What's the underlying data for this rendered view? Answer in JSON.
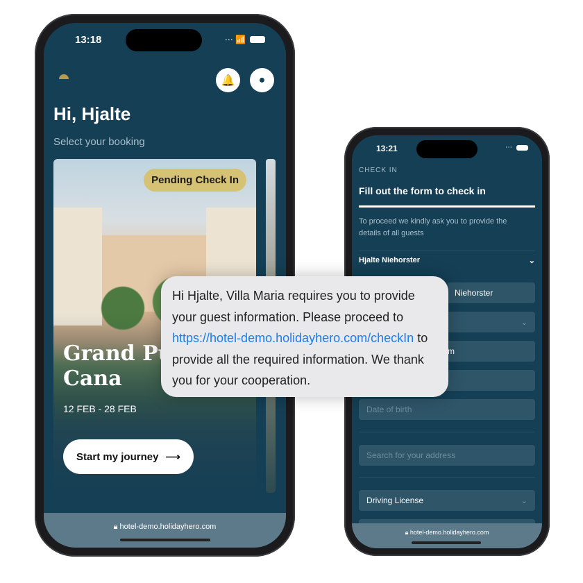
{
  "phone_left": {
    "status": {
      "time": "13:18"
    },
    "greeting": "Hi, Hjalte",
    "subtitle": "Select your booking",
    "icons": {
      "notifications": "bell-icon",
      "profile": "user-icon",
      "logo": "hotel-logo"
    },
    "booking": {
      "badge": "Pending Check In",
      "hotel": "Grand Punta Cana",
      "dates": "12 FEB - 28 FEB",
      "button": "Start my journey",
      "button_icon": "arrow-right"
    },
    "url": "hotel-demo.holidayhero.com"
  },
  "phone_right": {
    "status": {
      "time": "13:21"
    },
    "eyebrow": "CHECK IN",
    "title": "Fill out the form to check in",
    "intro": "To proceed we kindly ask you to provide the details of all guests",
    "guest": "Hjalte Niehorster",
    "fields": {
      "last_name": "Niehorster",
      "partial": "m",
      "dob_placeholder": "Date of birth",
      "address_placeholder": "Search for your address",
      "document_type": "Driving License"
    },
    "url": "hotel-demo.holidayhero.com"
  },
  "message": {
    "text_before": "Hi Hjalte, Villa Maria requires you to provide your guest information. Please proceed to",
    "link": "https://hotel-demo.holidayhero.com/checkIn",
    "text_after": "to provide all the required information. We thank you for your cooperation."
  },
  "colors": {
    "app_bg": "#143f55",
    "badge": "#d6c274",
    "link": "#1a7df0",
    "bubble": "#e9e9eb"
  }
}
